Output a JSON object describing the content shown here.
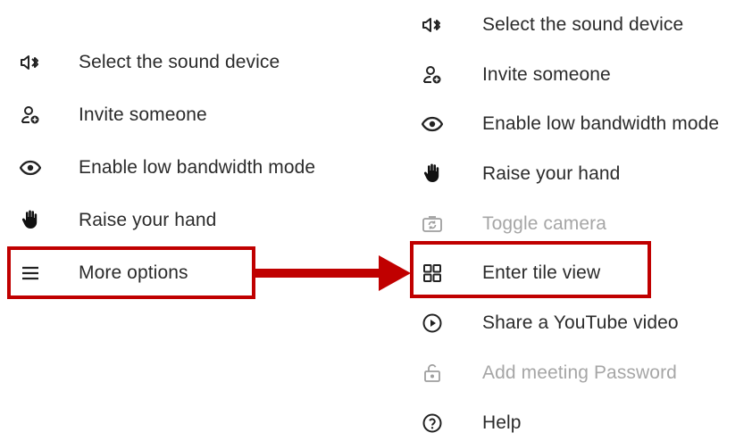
{
  "left_menu": {
    "items": [
      {
        "icon": "speaker-bluetooth-icon",
        "label": "Select the sound device"
      },
      {
        "icon": "person-add-icon",
        "label": "Invite someone"
      },
      {
        "icon": "eye-icon",
        "label": "Enable low bandwidth mode"
      },
      {
        "icon": "hand-icon",
        "label": "Raise your hand"
      },
      {
        "icon": "menu-lines-icon",
        "label": "More options"
      }
    ]
  },
  "right_menu": {
    "items": [
      {
        "icon": "speaker-bluetooth-icon",
        "label": "Select the sound device",
        "disabled": false
      },
      {
        "icon": "person-add-icon",
        "label": "Invite someone",
        "disabled": false
      },
      {
        "icon": "eye-icon",
        "label": "Enable low bandwidth mode",
        "disabled": false
      },
      {
        "icon": "hand-icon",
        "label": "Raise your hand",
        "disabled": false
      },
      {
        "icon": "camera-switch-icon",
        "label": "Toggle camera",
        "disabled": true
      },
      {
        "icon": "tile-grid-icon",
        "label": "Enter tile view",
        "disabled": false
      },
      {
        "icon": "play-circle-icon",
        "label": "Share a YouTube video",
        "disabled": false
      },
      {
        "icon": "unlock-icon",
        "label": "Add meeting Password",
        "disabled": true
      },
      {
        "icon": "help-circle-icon",
        "label": "Help",
        "disabled": false
      }
    ]
  },
  "colors": {
    "highlight": "#c00000",
    "text": "#2b2b2b",
    "disabled_text": "#a6a6a6"
  }
}
